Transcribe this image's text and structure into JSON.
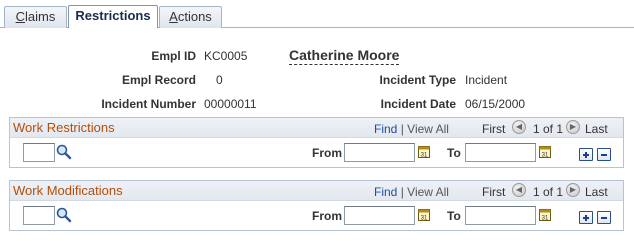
{
  "tabs": [
    {
      "label_underlined": "C",
      "label_rest": "laims",
      "active": false
    },
    {
      "label": "Restrictions",
      "active": true
    },
    {
      "label_underlined": "A",
      "label_rest": "ctions",
      "active": false
    }
  ],
  "header": {
    "empl_id_label": "Empl ID",
    "empl_id": "KC0005",
    "employee_name": "Catherine Moore",
    "empl_record_label": "Empl Record",
    "empl_record": "0",
    "incident_type_label": "Incident Type",
    "incident_type": "Incident",
    "incident_number_label": "Incident Number",
    "incident_number": "00000011",
    "incident_date_label": "Incident Date",
    "incident_date": "06/15/2000"
  },
  "work_restrictions": {
    "title": "Work Restrictions",
    "find": "Find",
    "separator": "|",
    "view_all": "View All",
    "first": "First",
    "range": "1 of 1",
    "last": "Last",
    "from_label": "From",
    "to_label": "To",
    "code_value": "",
    "from_value": "",
    "to_value": ""
  },
  "work_modifications": {
    "title": "Work Modifications",
    "find": "Find",
    "separator": "|",
    "view_all": "View All",
    "first": "First",
    "range": "1 of 1",
    "last": "Last",
    "from_label": "From",
    "to_label": "To",
    "code_value": "",
    "from_value": "",
    "to_value": ""
  }
}
